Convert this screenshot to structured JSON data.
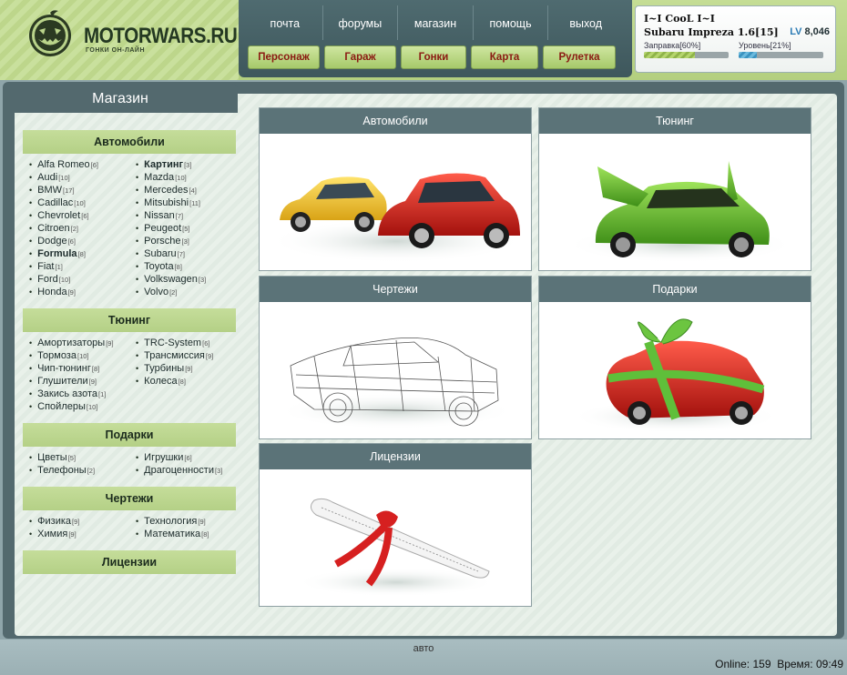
{
  "logo": {
    "name": "MOTORWARS.RU",
    "tagline": "ГОНКИ ОН-ЛАЙН"
  },
  "nav": {
    "top": [
      "почта",
      "форумы",
      "магазин",
      "помощь",
      "выход"
    ],
    "buttons": [
      "Персонаж",
      "Гараж",
      "Гонки",
      "Карта",
      "Рулетка"
    ]
  },
  "user": {
    "nick": "I~I CooL I~I",
    "car": "Subaru Impreza 1.6[15]",
    "lv_tag": "LV",
    "lv_value": "8,046",
    "fuel_label": "Заправка[60%]",
    "fuel_percent": 60,
    "level_label": "Уровень[21%]",
    "level_percent": 21
  },
  "shop_title": "Магазин",
  "sidebar": {
    "cars": {
      "title": "Автомобили",
      "col1": [
        {
          "name": "Alfa Romeo",
          "count": "[6]"
        },
        {
          "name": "Audi",
          "count": "[10]"
        },
        {
          "name": "BMW",
          "count": "[17]"
        },
        {
          "name": "Cadillac",
          "count": "[10]"
        },
        {
          "name": "Chevrolet",
          "count": "[6]"
        },
        {
          "name": "Citroen",
          "count": "[2]"
        },
        {
          "name": "Dodge",
          "count": "[6]"
        },
        {
          "name": "Formula",
          "count": "[8]"
        },
        {
          "name": "Fiat",
          "count": "[1]"
        },
        {
          "name": "Ford",
          "count": "[10]"
        },
        {
          "name": "Honda",
          "count": "[9]"
        }
      ],
      "col2": [
        {
          "name": "Картинг",
          "count": "[3]"
        },
        {
          "name": "Mazda",
          "count": "[10]"
        },
        {
          "name": "Mercedes",
          "count": "[4]"
        },
        {
          "name": "Mitsubishi",
          "count": "[11]"
        },
        {
          "name": "Nissan",
          "count": "[7]"
        },
        {
          "name": "Peugeot",
          "count": "[5]"
        },
        {
          "name": "Porsche",
          "count": "[3]"
        },
        {
          "name": "Subaru",
          "count": "[7]"
        },
        {
          "name": "Toyota",
          "count": "[8]"
        },
        {
          "name": "Volkswagen",
          "count": "[3]"
        },
        {
          "name": "Volvo",
          "count": "[2]"
        }
      ]
    },
    "tuning": {
      "title": "Тюнинг",
      "col1": [
        {
          "name": "Амортизаторы",
          "count": "[9]"
        },
        {
          "name": "Тормоза",
          "count": "[10]"
        },
        {
          "name": "Чип-тюнинг",
          "count": "[8]"
        },
        {
          "name": "Глушители",
          "count": "[9]"
        },
        {
          "name": "Закись азота",
          "count": "[1]"
        },
        {
          "name": "Спойлеры",
          "count": "[10]"
        }
      ],
      "col2": [
        {
          "name": "TRC-System",
          "count": "[6]"
        },
        {
          "name": "Трансмиссия",
          "count": "[9]"
        },
        {
          "name": "Турбины",
          "count": "[9]"
        },
        {
          "name": "Колеса",
          "count": "[8]"
        }
      ]
    },
    "gifts": {
      "title": "Подарки",
      "col1": [
        {
          "name": "Цветы",
          "count": "[5]"
        },
        {
          "name": "Телефоны",
          "count": "[2]"
        }
      ],
      "col2": [
        {
          "name": "Игрушки",
          "count": "[6]"
        },
        {
          "name": "Драгоценности",
          "count": "[3]"
        }
      ]
    },
    "blueprints": {
      "title": "Чертежи",
      "col1": [
        {
          "name": "Физика",
          "count": "[9]"
        },
        {
          "name": "Химия",
          "count": "[9]"
        }
      ],
      "col2": [
        {
          "name": "Технология",
          "count": "[9]"
        },
        {
          "name": "Математика",
          "count": "[8]"
        }
      ]
    },
    "licenses": {
      "title": "Лицензии"
    }
  },
  "tiles": {
    "cars": "Автомобили",
    "tuning": "Тюнинг",
    "blueprints": "Чертежи",
    "gifts": "Подарки",
    "licenses": "Лицензии"
  },
  "footer": {
    "center": "авто",
    "online_label": "Online:",
    "online_value": "159",
    "time_label": "Время:",
    "time_value": "09:49"
  },
  "colors": {
    "header_green": "#c5dd95",
    "panel_teal": "#53696e",
    "button_text": "#8b1a12",
    "section_green": "#c5dd9a"
  },
  "icons": [
    "pumpkin-logo-icon"
  ]
}
